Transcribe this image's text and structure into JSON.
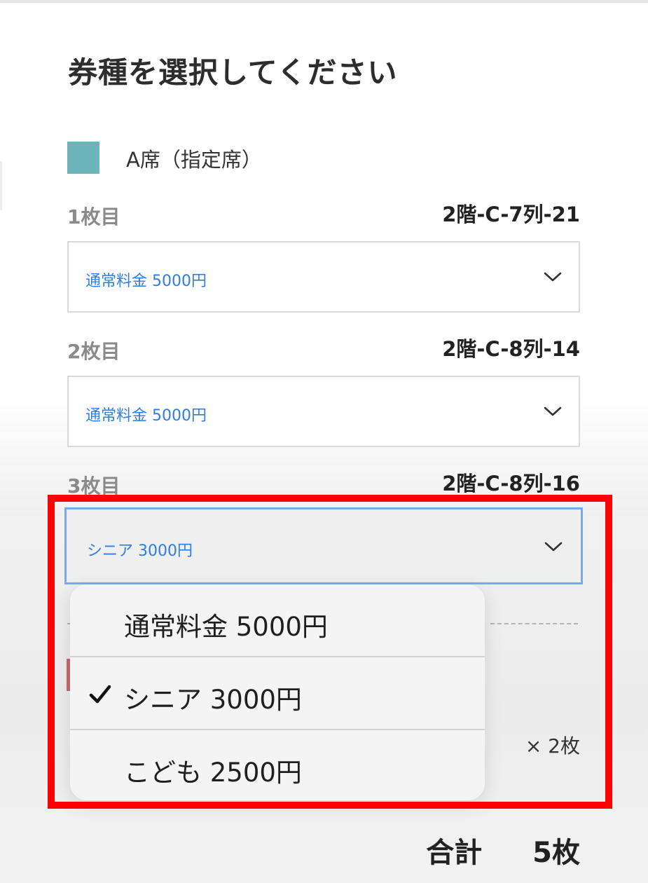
{
  "page": {
    "title": "券種を選択してください"
  },
  "seat_type": {
    "label": "A席（指定席）",
    "color": "#6cb3ba"
  },
  "tickets": [
    {
      "label": "1枚目",
      "seat": "2階-C-7列-21",
      "selected": "通常料金 5000円"
    },
    {
      "label": "2枚目",
      "seat": "2階-C-8列-14",
      "selected": "通常料金 5000円"
    },
    {
      "label": "3枚目",
      "seat": "2階-C-8列-16",
      "selected": "シニア 3000円"
    }
  ],
  "dropdown": {
    "options": [
      {
        "label": "通常料金 5000円",
        "checked": false
      },
      {
        "label": "シニア 3000円",
        "checked": true
      },
      {
        "label": "こども 2500円",
        "checked": false
      }
    ]
  },
  "quantity": "× 2枚",
  "total": {
    "label": "合計",
    "value": "5枚"
  },
  "colors": {
    "accent": "#2f7de1",
    "focus": "#7ba9e8",
    "highlight": "#ff0000"
  }
}
